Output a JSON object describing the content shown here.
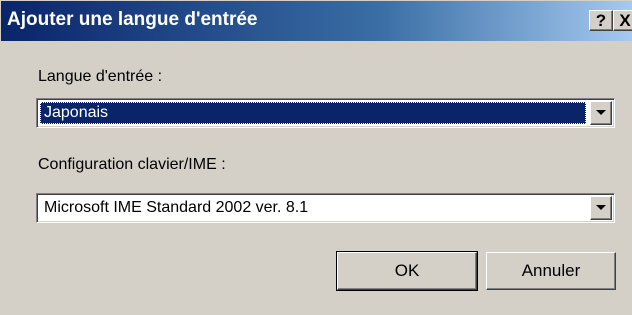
{
  "window": {
    "title": "Ajouter une langue d'entrée",
    "help_label": "?",
    "close_label": "X"
  },
  "input_language": {
    "label": "Langue d'entrée :",
    "value": "Japonais"
  },
  "keyboard_layout": {
    "label": "Configuration clavier/IME :",
    "value": "Microsoft IME Standard 2002 ver. 8.1"
  },
  "buttons": {
    "ok_label": "OK",
    "cancel_label": "Annuler"
  },
  "colors": {
    "titlebar": "#0a246a",
    "dialog_face": "#d4d0c8",
    "selection": "#0a246a"
  },
  "icons": {
    "dropdown": "chevron-down-icon"
  }
}
